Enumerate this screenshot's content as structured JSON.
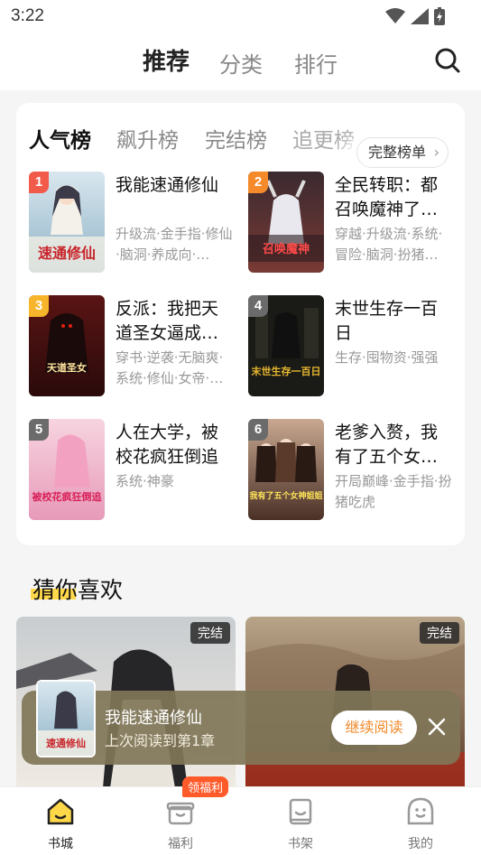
{
  "status": {
    "time": "3:22"
  },
  "topnav": {
    "tabs": [
      {
        "label": "推荐",
        "active": true
      },
      {
        "label": "分类",
        "active": false
      },
      {
        "label": "排行",
        "active": false
      }
    ],
    "search_icon": "search-icon"
  },
  "ranking": {
    "tabs": [
      "人气榜",
      "飙升榜",
      "完结榜",
      "追更榜"
    ],
    "active_tab": "人气榜",
    "full_list_label": "完整榜单",
    "books": [
      {
        "rank": "1",
        "title": "我能速通修仙",
        "tags": "升级流·金手指·修仙·脑洞·养成向·…",
        "cover_text": "速通修仙"
      },
      {
        "rank": "2",
        "title": "全民转职：都召唤魔神了…",
        "tags": "穿越·升级流·系统·冒险·脑洞·扮猪…",
        "cover_text": "召唤魔神"
      },
      {
        "rank": "3",
        "title": "反派：我把天道圣女逼成…",
        "tags": "穿书·逆袭·无脑爽·系统·修仙·女帝·…",
        "cover_text": "天道圣女"
      },
      {
        "rank": "4",
        "title": "末世生存一百日",
        "tags": "生存·囤物资·强强",
        "cover_text": "末世生存一百日"
      },
      {
        "rank": "5",
        "title": "人在大学，被校花疯狂倒追",
        "tags": "系统·神豪",
        "cover_text": "被校花疯狂倒追"
      },
      {
        "rank": "6",
        "title": "老爹入赘，我有了五个女…",
        "tags": "开局巅峰·金手指·扮猪吃虎",
        "cover_text": "我有了五个女神姐姐"
      }
    ]
  },
  "guess": {
    "title": "猜你喜欢",
    "items": [
      {
        "badge": "完结"
      },
      {
        "badge": "完结"
      }
    ]
  },
  "continue_reading": {
    "title": "我能速通修仙",
    "progress": "上次阅读到第1章",
    "button": "继续阅读"
  },
  "bottom_nav": {
    "welfare_badge": "领福利",
    "items": [
      {
        "label": "书城",
        "icon": "home-icon",
        "active": true
      },
      {
        "label": "福利",
        "icon": "gift-icon",
        "active": false
      },
      {
        "label": "书架",
        "icon": "bookshelf-icon",
        "active": false
      },
      {
        "label": "我的",
        "icon": "profile-icon",
        "active": false
      }
    ]
  },
  "colors": {
    "accent": "#ffd84a",
    "button_text": "#f08a2a",
    "badge": "#ff5a2a",
    "rank1": "#f25a4a",
    "rank2": "#f58a2a",
    "rank3": "#f7b52c",
    "rank_other": "#6b6b6b"
  }
}
